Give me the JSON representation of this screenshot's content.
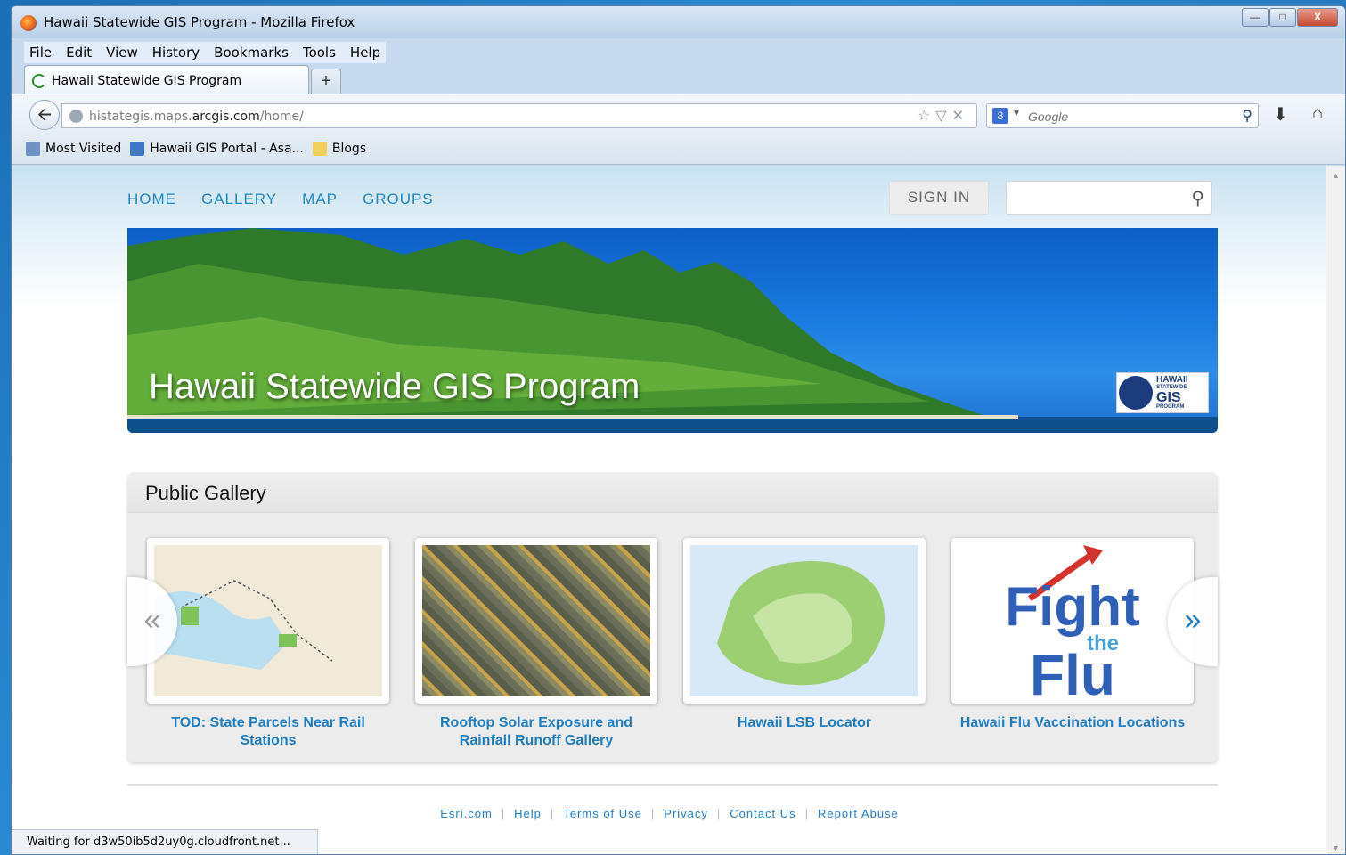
{
  "window": {
    "title": "Hawaii Statewide GIS Program - Mozilla Firefox",
    "controls": [
      "minimize",
      "maximize",
      "close"
    ]
  },
  "menu": [
    "File",
    "Edit",
    "View",
    "History",
    "Bookmarks",
    "Tools",
    "Help"
  ],
  "tab": {
    "label": "Hawaii Statewide GIS Program",
    "new_tab": "+"
  },
  "address": {
    "prefix": "histategis.maps.",
    "domain": "arcgis.com",
    "path": "/home/",
    "search_placeholder": "Google"
  },
  "bookmarks": [
    {
      "label": "Most Visited",
      "icon": "most-visited-icon"
    },
    {
      "label": "Hawaii GIS Portal - Asa...",
      "icon": "arcgis-icon"
    },
    {
      "label": "Blogs",
      "icon": "folder-icon"
    }
  ],
  "site": {
    "nav": [
      "HOME",
      "GALLERY",
      "MAP",
      "GROUPS"
    ],
    "sign_in": "SIGN IN",
    "banner_title": "Hawaii Statewide GIS Program",
    "logo": [
      "HAWAII",
      "STATEWIDE",
      "GIS",
      "PROGRAM"
    ],
    "gallery_title": "Public Gallery",
    "prev_arrow": "«",
    "next_arrow": "»",
    "items": [
      {
        "title": "TOD: State Parcels Near Rail Stations"
      },
      {
        "title": "Rooftop Solar Exposure and Rainfall Runoff Gallery"
      },
      {
        "title": "Hawaii LSB Locator"
      },
      {
        "title": "Hawaii Flu Vaccination Locations",
        "image_text": [
          "Fight",
          "the",
          "Flu"
        ]
      }
    ],
    "footer": [
      "Esri.com",
      "Help",
      "Terms of Use",
      "Privacy",
      "Contact Us",
      "Report Abuse"
    ]
  },
  "status_text": "Waiting for d3w50ib5d2uy0g.cloudfront.net..."
}
